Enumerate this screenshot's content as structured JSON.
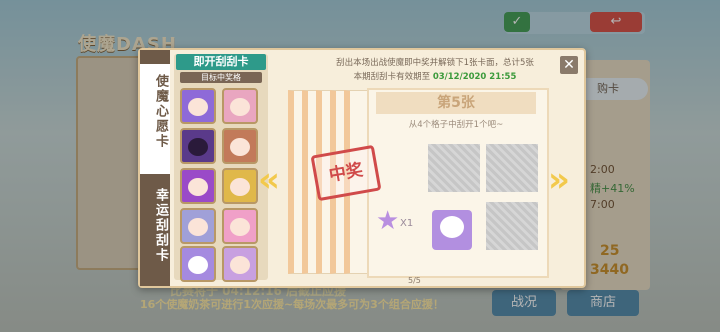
{
  "background": {
    "title": "使魔DASH",
    "gouka_label": "购卡",
    "stat_time": "2:00",
    "stat_bonus": "精+41%",
    "stat_time2": "7:00",
    "value1": "25",
    "value2": "3440",
    "timer": "比赛将于 04:12:16 后截止应援",
    "hint": "16个使魔奶茶可进行1次应援~每场次最多可为3个组合应援！",
    "tab_battle": "战况",
    "tab_shop": "商店"
  },
  "modal": {
    "tabs": [
      "使魔心愿卡",
      "幸运刮刮卡"
    ],
    "gallery_title": "即开刮刮卡",
    "gallery_subtitle": "目标中奖格",
    "info_line1": "刮出本场出战使魔即中奖并解锁下1张卡面，总计5张",
    "info_line2_prefix": "本期刮刮卡有效期至",
    "info_line2_date": "03/12/2020 21:55",
    "card_title": "第5张",
    "card_hint": "从4个格子中刮开1个吧~",
    "stamp_text": "中奖",
    "star_count": "X1",
    "page_indicator": "5/5",
    "close_label": "✕"
  },
  "colors": {
    "accent": "#2e9a8a",
    "stamp": "#d04a4a",
    "arrow": "#f2c94c"
  }
}
